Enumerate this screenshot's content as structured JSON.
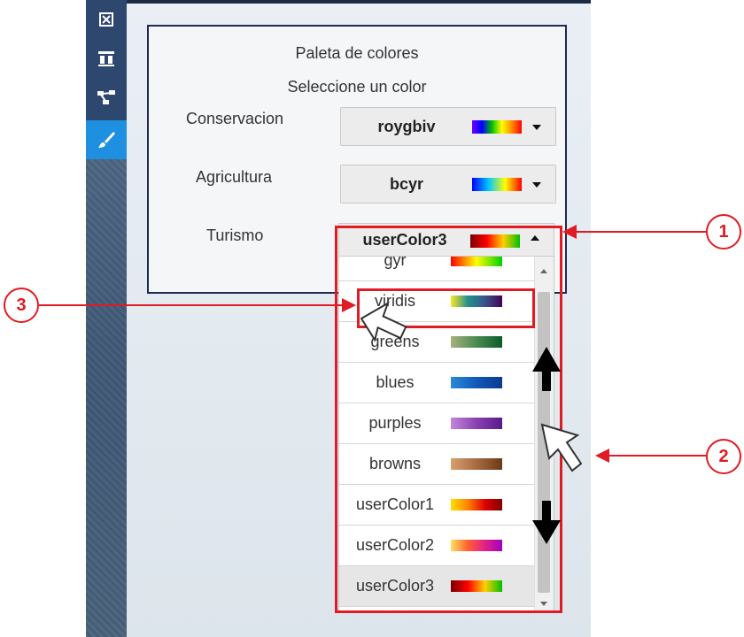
{
  "toolbar": {
    "buttons": [
      {
        "icon": "frame-icon",
        "active": false
      },
      {
        "icon": "layers-icon",
        "active": false
      },
      {
        "icon": "network-icon",
        "active": false
      },
      {
        "icon": "paintbrush-icon",
        "active": true
      }
    ]
  },
  "panel": {
    "title": "Paleta de colores",
    "subtitle": "Seleccione un color",
    "fields": [
      {
        "label": "Conservacion",
        "value": "roygbiv",
        "palette": "roygbiv"
      },
      {
        "label": "Agricultura",
        "value": "bcyr",
        "palette": "bcyr"
      },
      {
        "label": "Turismo",
        "value": "userColor3",
        "palette": "userColor3",
        "open": true
      }
    ]
  },
  "dropdown": {
    "options": [
      {
        "label": "gyr",
        "palette": "gyr"
      },
      {
        "label": "viridis",
        "palette": "viridis"
      },
      {
        "label": "greens",
        "palette": "greens"
      },
      {
        "label": "blues",
        "palette": "blues"
      },
      {
        "label": "purples",
        "palette": "purples"
      },
      {
        "label": "browns",
        "palette": "browns"
      },
      {
        "label": "userColor1",
        "palette": "userColor1"
      },
      {
        "label": "userColor2",
        "palette": "userColor2"
      },
      {
        "label": "userColor3",
        "palette": "userColor3",
        "selected": true
      }
    ]
  },
  "palettes": {
    "roygbiv": [
      "#6a00ff",
      "#0000ff",
      "#00c000",
      "#ffff00",
      "#ff8c00",
      "#ff0000"
    ],
    "bcyr": [
      "#0000ff",
      "#00c8ff",
      "#ffff00",
      "#ff0000"
    ],
    "userColor3": [
      "#7a0000",
      "#ff0000",
      "#ffd000",
      "#00c000"
    ],
    "gyr": [
      "#ff0000",
      "#ffff00",
      "#00d000"
    ],
    "viridis": [
      "#fde725",
      "#21918c",
      "#3b528b",
      "#440154"
    ],
    "greens": [
      "#a8b080",
      "#4a8a50",
      "#0a5e2a"
    ],
    "blues": [
      "#2a8ad8",
      "#1258b8",
      "#0a3a90"
    ],
    "purples": [
      "#c088d8",
      "#8a40b0",
      "#5a1a8a"
    ],
    "browns": [
      "#d6a070",
      "#a86a40",
      "#6a3a18"
    ],
    "userColor1": [
      "#ffe000",
      "#ff8000",
      "#e00000",
      "#800000"
    ],
    "userColor2": [
      "#ffe060",
      "#ff6030",
      "#e0208a",
      "#a000c0"
    ]
  },
  "annotations": {
    "callouts": [
      "1",
      "2",
      "3"
    ],
    "color": "#e01b24"
  }
}
